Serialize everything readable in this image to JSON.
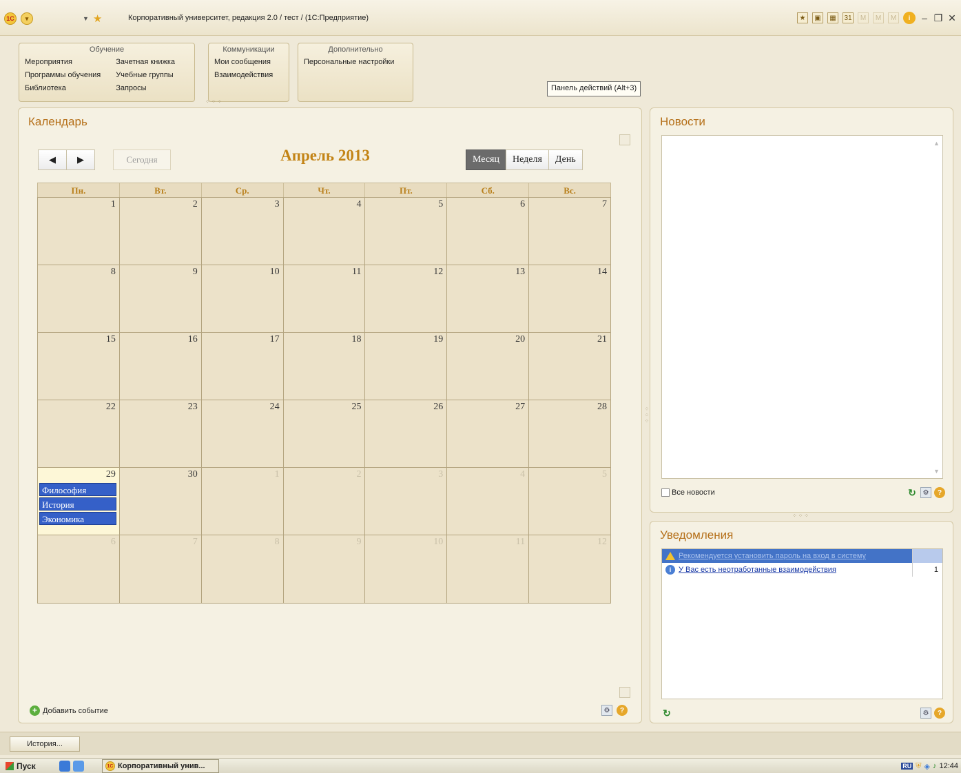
{
  "window": {
    "title": "Корпоративный университет, редакция 2.0 / тест / (1С:Предприятие)"
  },
  "sections": {
    "training": {
      "title": "Обучение",
      "col1": [
        "Мероприятия",
        "Программы обучения",
        "Библиотека"
      ],
      "col2": [
        "Зачетная книжка",
        "Учебные группы",
        "Запросы"
      ]
    },
    "communications": {
      "title": "Коммуникации",
      "items": [
        "Мои сообщения",
        "Взаимодействия"
      ]
    },
    "extra": {
      "title": "Дополнительно",
      "items": [
        "Персональные настройки"
      ]
    },
    "hint": "Панель действий (Alt+3)"
  },
  "calendar": {
    "title": "Календарь",
    "today_label": "Сегодня",
    "month_title": "Апрель 2013",
    "views": [
      "Месяц",
      "Неделя",
      "День"
    ],
    "active_view": "Месяц",
    "weekdays": [
      "Пн.",
      "Вт.",
      "Ср.",
      "Чт.",
      "Пт.",
      "Сб.",
      "Вс."
    ],
    "weeks": [
      [
        "1",
        "2",
        "3",
        "4",
        "5",
        "6",
        "7"
      ],
      [
        "8",
        "9",
        "10",
        "11",
        "12",
        "13",
        "14"
      ],
      [
        "15",
        "16",
        "17",
        "18",
        "19",
        "20",
        "21"
      ],
      [
        "22",
        "23",
        "24",
        "25",
        "26",
        "27",
        "28"
      ],
      [
        "29",
        "30",
        "1",
        "2",
        "3",
        "4",
        "5"
      ],
      [
        "6",
        "7",
        "8",
        "9",
        "10",
        "11",
        "12"
      ]
    ],
    "events_day_29": [
      "Философия",
      "История",
      "Экономика"
    ],
    "add_event_label": "Добавить событие"
  },
  "news": {
    "title": "Новости",
    "all_news_label": "Все новости"
  },
  "notifications": {
    "title": "Уведомления",
    "items": [
      {
        "text": "Рекомендуется установить пароль на вход в систему",
        "count": "",
        "icon": "warning-icon"
      },
      {
        "text": "У Вас есть неотработанные взаимодействия",
        "count": "1",
        "icon": "info-icon"
      }
    ]
  },
  "history_button": "История...",
  "taskbar": {
    "start": "Пуск",
    "task": "Корпоративный унив...",
    "lang": "RU",
    "time": "12:44"
  },
  "colors": {
    "accent": "#b5701a",
    "event": "#3560c8",
    "panel_bg": "#f5f1e3"
  }
}
